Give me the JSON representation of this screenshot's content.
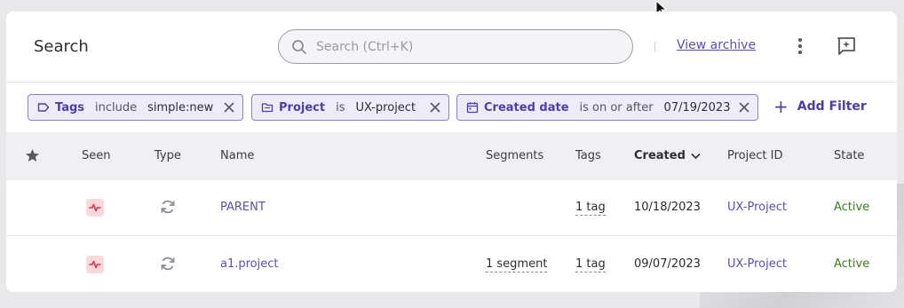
{
  "header": {
    "title": "Search",
    "search_placeholder": "Search (Ctrl+K)",
    "view_archive": "View archive"
  },
  "filters": [
    {
      "field": "Tags",
      "op": "include",
      "value": "simple:new"
    },
    {
      "field": "Project",
      "op": "is",
      "value": "UX-project"
    },
    {
      "field": "Created date",
      "op": "is on or after",
      "value": "07/19/2023"
    }
  ],
  "add_filter_label": "Add Filter",
  "columns": {
    "seen": "Seen",
    "type": "Type",
    "name": "Name",
    "segments": "Segments",
    "tags": "Tags",
    "created": "Created",
    "project_id": "Project ID",
    "state": "State"
  },
  "rows": [
    {
      "name": "PARENT",
      "segments": "",
      "tags": "1 tag",
      "created": "10/18/2023",
      "project_id": "UX-Project",
      "state": "Active"
    },
    {
      "name": "a1.project",
      "segments": "1 segment",
      "tags": "1 tag",
      "created": "09/07/2023",
      "project_id": "UX-Project",
      "state": "Active"
    }
  ],
  "colors": {
    "accent": "#4b3fa7",
    "chip_bg": "#eeecfa",
    "active": "#3a7a1f",
    "seen_bg": "#fcd8dc"
  }
}
